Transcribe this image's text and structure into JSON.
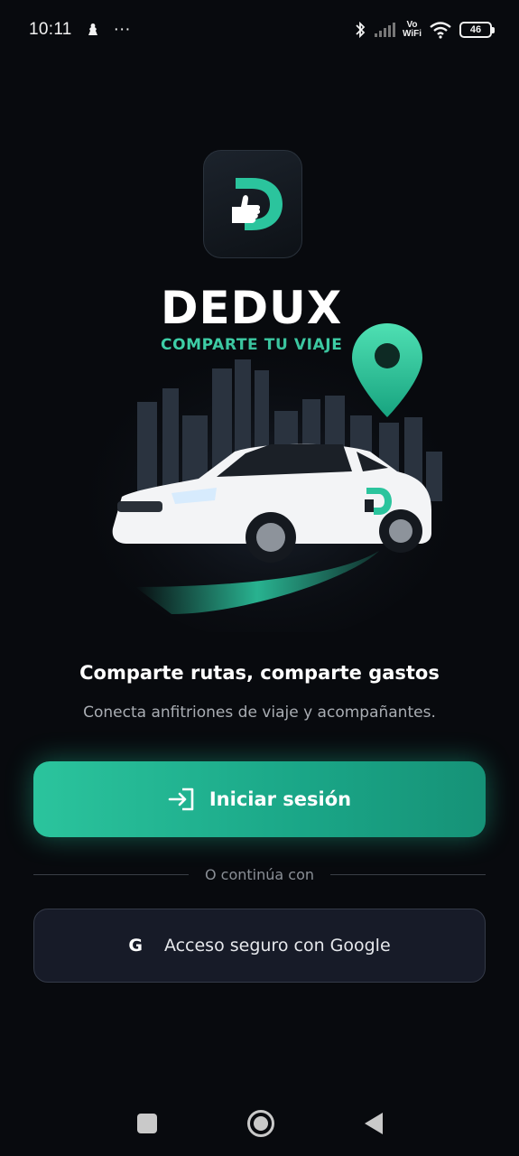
{
  "status_bar": {
    "time": "10:11",
    "extra": "···",
    "volte_top": "Vo",
    "volte_bottom": "WiFi",
    "battery": "46"
  },
  "brand": {
    "name": "DEDUX",
    "tagline": "COMPARTE TU VIAJE",
    "accent_color": "#2bc49d"
  },
  "content": {
    "headline": "Comparte rutas, comparte gastos",
    "subline": "Conecta anfitriones de viaje y acompañantes."
  },
  "login_button": {
    "label": "Iniciar sesión",
    "icon": "login-icon"
  },
  "divider": {
    "text": "O continúa con"
  },
  "google_button": {
    "icon": "G",
    "label": "Acceso seguro con Google"
  },
  "nav": {
    "recent": "recents-icon",
    "home": "home-icon",
    "back": "back-icon"
  }
}
